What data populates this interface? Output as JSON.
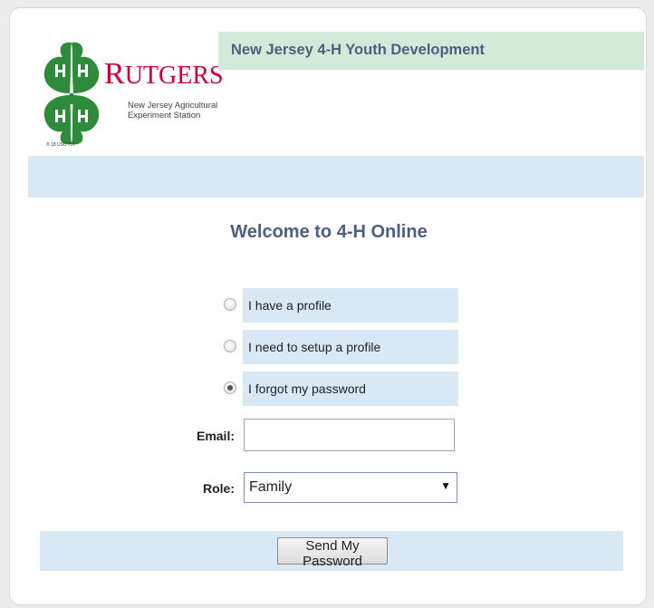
{
  "header": {
    "title": "New Jersey 4-H Youth Development"
  },
  "logo": {
    "icon": "four-leaf-clover-icon",
    "brand_first": "R",
    "brand_rest": "UTGERS",
    "subtitle_line1": "New Jersey Agricultural",
    "subtitle_line2": "Experiment Station",
    "mark": "® 18 USC 707",
    "colors": {
      "clover": "#2e8b3a",
      "brand": "#cc0033"
    }
  },
  "main": {
    "welcome": "Welcome to 4-H Online"
  },
  "options": [
    {
      "label": "I have a profile",
      "checked": false
    },
    {
      "label": "I need to setup a profile",
      "checked": false
    },
    {
      "label": "I forgot my password",
      "checked": true
    }
  ],
  "form": {
    "email_label": "Email:",
    "email_value": "",
    "role_label": "Role:",
    "role_value": "Family"
  },
  "actions": {
    "send_label": "Send My Password"
  }
}
